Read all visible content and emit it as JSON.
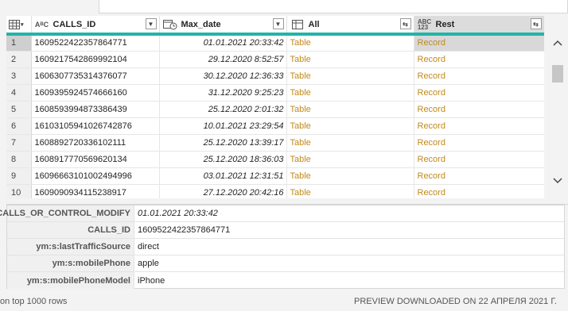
{
  "columns": [
    {
      "name": "CALLS_ID",
      "type_icon": "ABC"
    },
    {
      "name": "Max_date",
      "type_icon": "date-time-icon"
    },
    {
      "name": "All",
      "type_icon": "table-icon"
    },
    {
      "name": "Rest",
      "type_icon": "ABC 123"
    }
  ],
  "rows": [
    {
      "n": "1",
      "calls_id": "1609522422357864771",
      "max_date": "01.01.2021 20:33:42",
      "all": "Table",
      "rest": "Record"
    },
    {
      "n": "2",
      "calls_id": "1609217542869992104",
      "max_date": "29.12.2020 8:52:57",
      "all": "Table",
      "rest": "Record"
    },
    {
      "n": "3",
      "calls_id": "1606307735314376077",
      "max_date": "30.12.2020 12:36:33",
      "all": "Table",
      "rest": "Record"
    },
    {
      "n": "4",
      "calls_id": "1609395924574666160",
      "max_date": "31.12.2020 9:25:23",
      "all": "Table",
      "rest": "Record"
    },
    {
      "n": "5",
      "calls_id": "1608593994873386439",
      "max_date": "25.12.2020 2:01:32",
      "all": "Table",
      "rest": "Record"
    },
    {
      "n": "6",
      "calls_id": "1610310594102674287­6",
      "max_date": "10.01.2021 23:29:54",
      "all": "Table",
      "rest": "Record"
    },
    {
      "n": "7",
      "calls_id": "1608892720336102111",
      "max_date": "25.12.2020 13:39:17",
      "all": "Table",
      "rest": "Record"
    },
    {
      "n": "8",
      "calls_id": "1608917770569620134",
      "max_date": "25.12.2020 18:36:03",
      "all": "Table",
      "rest": "Record"
    },
    {
      "n": "9",
      "calls_id": "1609666310100249499­6",
      "max_date": "03.01.2021 12:31:51",
      "all": "Table",
      "rest": "Record"
    },
    {
      "n": "10",
      "calls_id": "1609090934115238917",
      "max_date": "27.12.2020 20:42:16",
      "all": "Table",
      "rest": "Record"
    }
  ],
  "detail": [
    {
      "key": "CALLS_OR_CONTROL_MODIFY",
      "value": "01.01.2021 20:33:42"
    },
    {
      "key": "CALLS_ID",
      "value": "1609522422357864771"
    },
    {
      "key": "ym:s:lastTrafficSource",
      "value": "direct"
    },
    {
      "key": "ym:s:mobilePhone",
      "value": "apple"
    },
    {
      "key": "ym:s:mobilePhoneModel",
      "value": "iPhone"
    }
  ],
  "status": {
    "left": "on top 1000 rows",
    "right": "PREVIEW DOWNLOADED ON 22 АПРЕЛЯ 2021 Г."
  },
  "colors": {
    "accent": "#21b5a8",
    "link": "#c08a1e"
  }
}
